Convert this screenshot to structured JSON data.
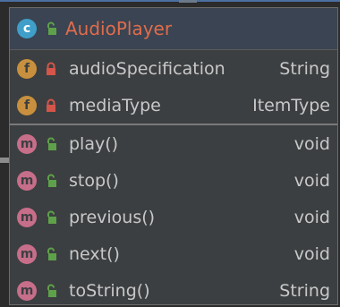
{
  "class": {
    "name": "AudioPlayer",
    "kind_icon": "class-icon",
    "kind_letter": "c",
    "visibility_icon": "public-unlock-icon"
  },
  "fields": [
    {
      "letter": "f",
      "visibility": "private-lock-icon",
      "name": "audioSpecification",
      "type": "String"
    },
    {
      "letter": "f",
      "visibility": "private-lock-icon",
      "name": "mediaType",
      "type": "ItemType"
    }
  ],
  "methods": [
    {
      "letter": "m",
      "visibility": "public-unlock-icon",
      "name": "play()",
      "type": "void"
    },
    {
      "letter": "m",
      "visibility": "public-unlock-icon",
      "name": "stop()",
      "type": "void"
    },
    {
      "letter": "m",
      "visibility": "public-unlock-icon",
      "name": "previous()",
      "type": "void"
    },
    {
      "letter": "m",
      "visibility": "public-unlock-icon",
      "name": "next()",
      "type": "void"
    },
    {
      "letter": "m",
      "visibility": "public-unlock-icon",
      "name": "toString()",
      "type": "String"
    }
  ],
  "colors": {
    "class_name": "#e06c4b",
    "class_badge": "#3f9fc9",
    "field_badge": "#c8903e",
    "method_badge": "#c76e8a",
    "public_visibility": "#5ea14a",
    "private_visibility": "#d4554a"
  }
}
